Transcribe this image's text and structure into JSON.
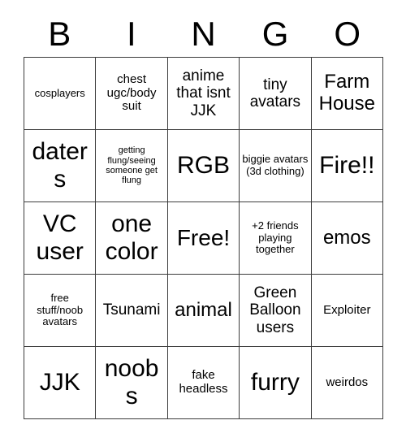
{
  "card": {
    "title": "BINGO",
    "header_letters": [
      "B",
      "I",
      "N",
      "G",
      "O"
    ],
    "colors": {
      "background": "#ffffff",
      "border": "#3c3c3c",
      "text": "#000000"
    },
    "grid_size": "5x5",
    "free_space_index": 12,
    "free_space_label": "Free!",
    "cells": [
      {
        "text": "cosplayers",
        "size": "sm"
      },
      {
        "text": "chest ugc/body suit",
        "size": "md"
      },
      {
        "text": "anime that isnt JJK",
        "size": "lg"
      },
      {
        "text": "tiny avatars",
        "size": "lg"
      },
      {
        "text": "Farm House",
        "size": "xl"
      },
      {
        "text": "daters",
        "size": "xxl"
      },
      {
        "text": "getting flung/seeing someone get flung",
        "size": "xs"
      },
      {
        "text": "RGB",
        "size": "xxl"
      },
      {
        "text": "biggie avatars (3d clothing)",
        "size": "sm"
      },
      {
        "text": "Fire!!",
        "size": "xxl"
      },
      {
        "text": "VC user",
        "size": "xxl"
      },
      {
        "text": "one color",
        "size": "xxl"
      },
      {
        "text": "Free!",
        "size": "free"
      },
      {
        "text": "+2 friends playing together",
        "size": "sm"
      },
      {
        "text": "emos",
        "size": "xl"
      },
      {
        "text": "free stuff/noob avatars",
        "size": "sm"
      },
      {
        "text": "Tsunami",
        "size": "lg"
      },
      {
        "text": "animal",
        "size": "xl"
      },
      {
        "text": "Green Balloon users",
        "size": "lg"
      },
      {
        "text": "Exploiter",
        "size": "md"
      },
      {
        "text": "JJK",
        "size": "xxl"
      },
      {
        "text": "noobs",
        "size": "xxl"
      },
      {
        "text": "fake headless",
        "size": "md"
      },
      {
        "text": "furry",
        "size": "xxl"
      },
      {
        "text": "weirdos",
        "size": "md"
      }
    ]
  }
}
